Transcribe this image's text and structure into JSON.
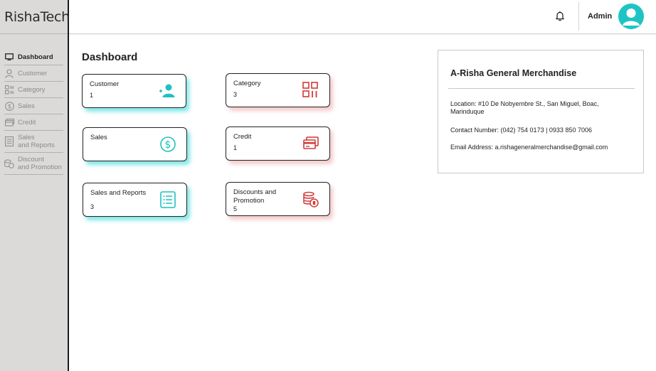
{
  "brand": "RishaTech",
  "sidebar": {
    "items": [
      {
        "label": "Dashboard",
        "icon": "monitor-icon"
      },
      {
        "label": "Customer",
        "icon": "user-icon"
      },
      {
        "label": "Category",
        "icon": "category-icon"
      },
      {
        "label": "Sales",
        "icon": "dollar-icon"
      },
      {
        "label": "Credit",
        "icon": "credit-card-icon"
      },
      {
        "label": "Sales\nand Reports",
        "icon": "report-icon"
      },
      {
        "label": "Discount\nand Promotion",
        "icon": "discount-icon"
      }
    ]
  },
  "header": {
    "admin_label": "Admin",
    "bell_icon": "bell-icon",
    "avatar_icon": "user-avatar-icon"
  },
  "main": {
    "title": "Dashboard",
    "cards": [
      {
        "label": "Customer",
        "value": "1",
        "icon": "add-user-icon",
        "color": "#1fc1c1"
      },
      {
        "label": "Category",
        "value": "3",
        "icon": "category-grid-icon",
        "color": "#d23a3a"
      },
      {
        "label": "Sales",
        "value": "",
        "icon": "dollar-circle-icon",
        "color": "#1fc1c1"
      },
      {
        "label": "Credit",
        "value": "1",
        "icon": "credit-cards-icon",
        "color": "#d23a3a"
      },
      {
        "label": "Sales and Reports",
        "value": "3",
        "icon": "list-report-icon",
        "color": "#1fc1c1"
      },
      {
        "label": "Discounts and\nPromotion",
        "value": "5",
        "icon": "coins-discount-icon",
        "color": "#d23a3a"
      }
    ]
  },
  "info": {
    "title": "A-Risha General Merchandise",
    "location": "Location: #10 De Nobyembre St., San Miguel, Boac, Marinduque",
    "contact": "Contact Number: (042) 754 0173 | 0933 850 7006",
    "email": "Email Address: a.rishageneralmerchandise@gmail.com"
  },
  "colors": {
    "teal": "#1fc1c1",
    "red": "#d23a3a",
    "sidebar_bg": "#dcdad8"
  }
}
